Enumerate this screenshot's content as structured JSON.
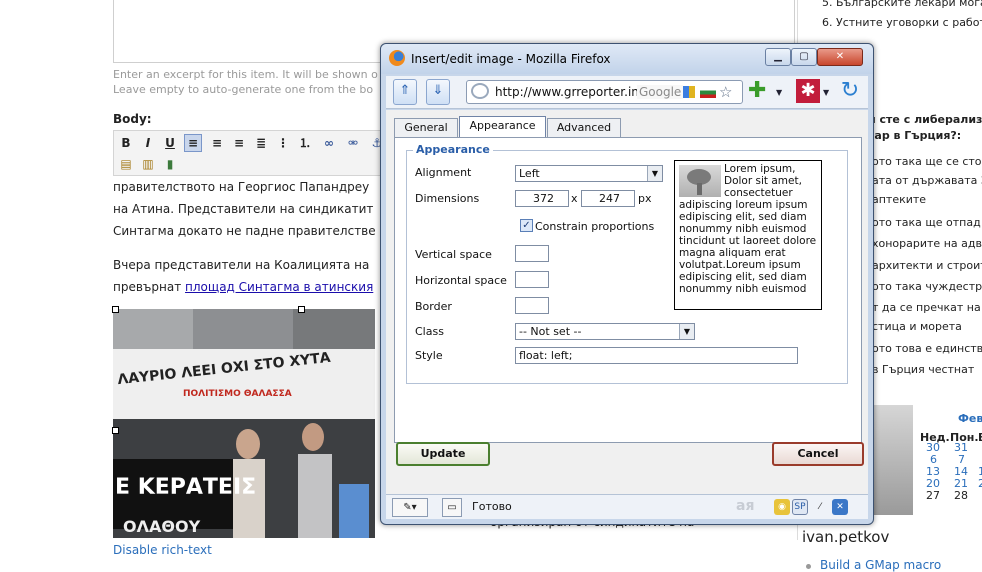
{
  "page": {
    "excerpt_hint_1": "Enter an excerpt for this item. It will be shown o",
    "excerpt_hint_2": "Leave empty to auto-generate one from the bo",
    "body_label": "Body:",
    "editor_lines": {
      "p1_l1": "правителството на Георгиос Папандреу",
      "p1_l2": "на Атина. Представители на синдикатит",
      "p1_l3": "Синтагма докато не падне правителстве",
      "p2_l1": "Вчера представители на Коалицията на",
      "p2_l2_prefix": "превърнат ",
      "p2_l2_link": "площад Синтагма в атинския"
    },
    "photo_banner_1": "ΛΑΥΡΙΟ ΛΕΕΙ ΟΧΙ ΣΤΟ ΧΥΤΑ",
    "photo_banner_2": "ΠΟΛΙΤΙΣΜΟ ΘΑΛΑΣΣΑ",
    "photo_banner_3": "Ε ΚΕΡΑΤΕΙΣ",
    "photo_banner_4": "ΟΛΑΘΟΥ",
    "behind_text": "организиран от синдикатите на",
    "disable_rich_text": "Disable rich-text"
  },
  "sidebar": {
    "items": [
      "5. Българските лекари могат",
      "6. Устните уговорки с работ"
    ],
    "poll_question_1": "и сте с либерализи",
    "poll_question_2": "зар в Гърция?:",
    "poll_options": [
      "ото така ще се сто",
      "ата от държавата З",
      "аптеките",
      "ото така ще отпад",
      "хонорарите на адв",
      "архитекти и строит",
      "ото така чуждестр",
      "т да се пречкат на",
      "стица и морета",
      "ото това е единств",
      "в Гърция честнат"
    ],
    "calendar_month": "Фев",
    "calendar_days": [
      "Нед.",
      "Пон.",
      "В"
    ],
    "calendar_rows": [
      [
        "30",
        "31",
        ""
      ],
      [
        "6",
        "7",
        ""
      ],
      [
        "13",
        "14",
        "1"
      ],
      [
        "20",
        "21",
        "2"
      ],
      [
        "27",
        "28",
        ""
      ]
    ],
    "username": "ivan.petkov",
    "gmap_link": "Build a GMap macro"
  },
  "dialog": {
    "title": "Insert/edit image - Mozilla Firefox",
    "url": "http://www.grreporter.inf",
    "search_engine": "Google",
    "tabs": [
      "General",
      "Appearance",
      "Advanced"
    ],
    "legend": "Appearance",
    "alignment_label": "Alignment",
    "alignment_value": "Left",
    "dimensions_label": "Dimensions",
    "width": "372",
    "height": "247",
    "times": "x",
    "unit": "px",
    "constrain_label": "Constrain proportions",
    "vspace_label": "Vertical space",
    "hspace_label": "Horizontal space",
    "border_label": "Border",
    "class_label": "Class",
    "class_value": "-- Not set --",
    "style_label": "Style",
    "style_value": "float: left;",
    "preview_text": "Lorem ipsum, Dolor sit amet, consectetuer adipiscing loreum ipsum edipiscing elit, sed diam nonummy nibh euismod tincidunt ut laoreet dolore magna aliquam erat volutpat.Loreum ipsum edipiscing elit, sed diam nonummy nibh euismod",
    "update_label": "Update",
    "cancel_label": "Cancel",
    "status_text": "Готово",
    "status_faded": "ая"
  }
}
